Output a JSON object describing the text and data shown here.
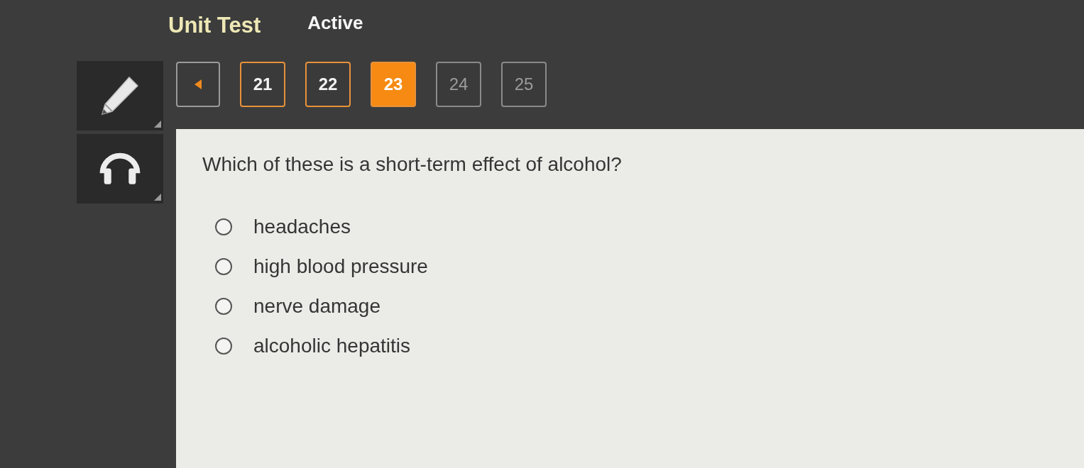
{
  "header": {
    "title": "Unit Test",
    "status": "Active"
  },
  "question_nav": [
    {
      "label": "21",
      "visited": true,
      "selected": false
    },
    {
      "label": "22",
      "visited": true,
      "selected": false
    },
    {
      "label": "23",
      "visited": true,
      "selected": true
    },
    {
      "label": "24",
      "visited": false,
      "selected": false
    },
    {
      "label": "25",
      "visited": false,
      "selected": false
    }
  ],
  "question": {
    "text": "Which of these is a short-term effect of alcohol?",
    "options": [
      {
        "label": "headaches",
        "selected": false
      },
      {
        "label": "high blood pressure",
        "selected": false
      },
      {
        "label": "nerve damage",
        "selected": false
      },
      {
        "label": "alcoholic hepatitis",
        "selected": false
      }
    ]
  }
}
